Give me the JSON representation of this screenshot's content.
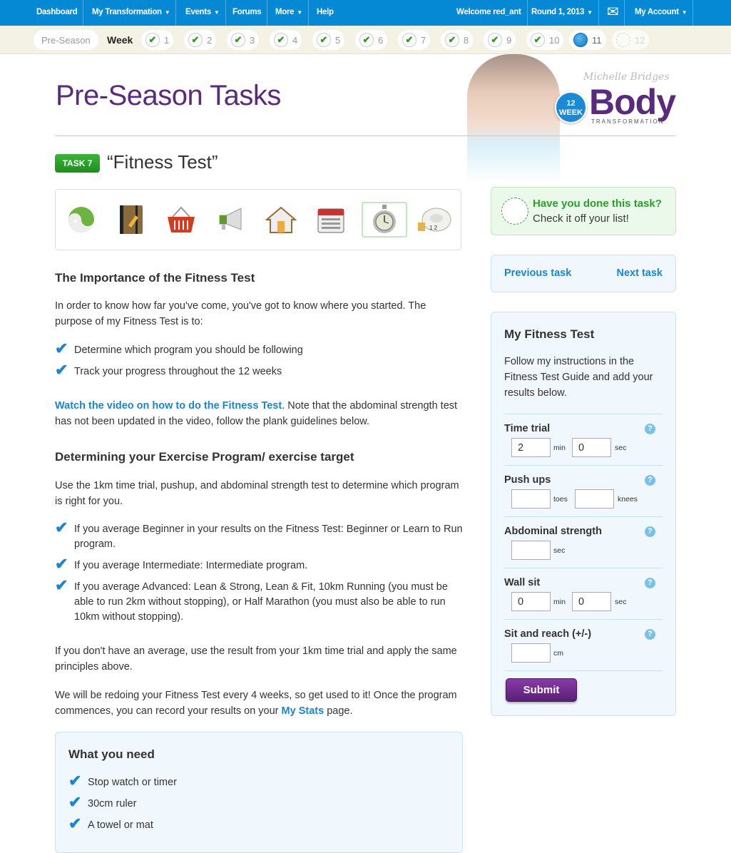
{
  "nav": {
    "left": [
      {
        "label": "Dashboard"
      },
      {
        "label": "My Transformation",
        "caret": true
      },
      {
        "label": "Events",
        "caret": true
      },
      {
        "label": "Forums"
      },
      {
        "label": "More",
        "caret": true
      },
      {
        "label": "Help"
      }
    ],
    "welcome": "Welcome red_ant",
    "round": "Round 1, 2013",
    "account": "My Account"
  },
  "weeks": {
    "preseason": "Pre-Season",
    "label": "Week",
    "items": [
      {
        "n": "1",
        "state": "done"
      },
      {
        "n": "2",
        "state": "done"
      },
      {
        "n": "3",
        "state": "done"
      },
      {
        "n": "4",
        "state": "done"
      },
      {
        "n": "5",
        "state": "done"
      },
      {
        "n": "6",
        "state": "done"
      },
      {
        "n": "7",
        "state": "done"
      },
      {
        "n": "8",
        "state": "done"
      },
      {
        "n": "9",
        "state": "done"
      },
      {
        "n": "10",
        "state": "done"
      },
      {
        "n": "11",
        "state": "current"
      },
      {
        "n": "12",
        "state": "future"
      }
    ]
  },
  "page_title": "Pre-Season Tasks",
  "logo": {
    "signature": "Michelle Bridges",
    "badge": "12 WEEK",
    "word": "Body",
    "sub": "TRANSFORMATION"
  },
  "task": {
    "badge": "TASK 7",
    "title": "“Fitness Test”"
  },
  "task_icons": [
    "yin-yang-icon",
    "notebook-icon",
    "basket-icon",
    "megaphone-icon",
    "house-icon",
    "calendar-icon",
    "stopwatch-icon",
    "tape-measure-icon"
  ],
  "content": {
    "h1": "The Importance of the Fitness Test",
    "p1": "In order to know how far you've come, you've got to know where you started. The purpose of my Fitness Test is to:",
    "list1": [
      "Determine which program you should be following",
      "Track your progress throughout the 12 weeks"
    ],
    "video_link": "Watch the video on how to do the Fitness Test",
    "p2": ". Note that the abdominal strength test has not been updated in the video, follow the plank guidelines below.",
    "h2": "Determining your Exercise Program/ exercise target",
    "p3": "Use the 1km time trial, pushup, and abdominal strength test to determine which program is right for you.",
    "list2": [
      "If you average Beginner in your results on the Fitness Test: Beginner or Learn to Run program.",
      "If you average Intermediate: Intermediate program.",
      "If you average Advanced: Lean & Strong, Lean & Fit, 10km Running (you must be able to run 2km without stopping), or Half Marathon (you must also be able to run 10km without stopping)."
    ],
    "p4": "If you don't have an average, use the result from your 1km time trial and apply the same principles above.",
    "p5": "We will be redoing your Fitness Test every 4 weeks, so get used to it! Once the program commences, you can record your results on your ",
    "stats_link": "My Stats",
    "p5_end": " page.",
    "need_title": "What you need",
    "need": [
      "Stop watch or timer",
      "30cm ruler",
      "A towel or mat"
    ]
  },
  "done": {
    "q": "Have you done this task?",
    "sub": "Check it off your list!"
  },
  "tasknav": {
    "prev": "Previous task",
    "next": "Next task"
  },
  "form": {
    "title": "My Fitness Test",
    "intro": "Follow my instructions in the Fitness Test Guide and add your results below.",
    "time_trial": {
      "label": "Time trial",
      "min": "2",
      "min_unit": "min",
      "sec": "0",
      "sec_unit": "sec"
    },
    "push_ups": {
      "label": "Push ups",
      "toes": "",
      "toes_unit": "toes",
      "knees": "",
      "knees_unit": "knees"
    },
    "abs": {
      "label": "Abdominal strength",
      "sec": "",
      "sec_unit": "sec"
    },
    "wall_sit": {
      "label": "Wall sit",
      "min": "0",
      "min_unit": "min",
      "sec": "0",
      "sec_unit": "sec"
    },
    "sit_reach": {
      "label": "Sit and reach (+/-)",
      "cm": "",
      "cm_unit": "cm"
    },
    "help": "?",
    "submit": "Submit"
  },
  "colors": {
    "nav": "#0589d4",
    "purple": "#5a2a7e",
    "green": "#2a9a1a",
    "link": "#1a85d0"
  }
}
